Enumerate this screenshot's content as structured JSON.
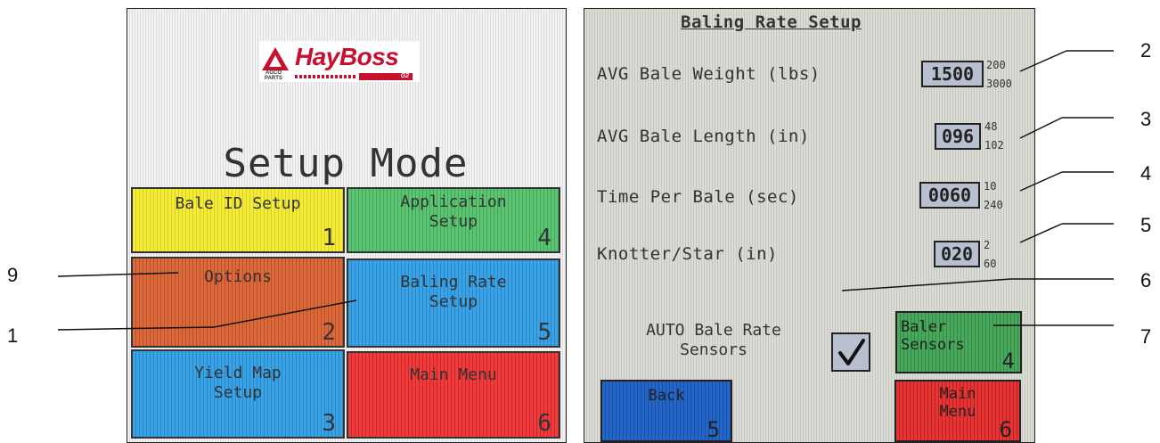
{
  "left_screen": {
    "logo": {
      "brand": "HayBoss",
      "badge": "G2",
      "maker": "AGCO PARTS"
    },
    "title": "Setup Mode",
    "tiles": [
      {
        "label": "Bale ID Setup",
        "number": "1"
      },
      {
        "label": "Application\nSetup",
        "number": "4"
      },
      {
        "label": "Options",
        "number": "2"
      },
      {
        "label": "Baling Rate\nSetup",
        "number": "5"
      },
      {
        "label": "Yield Map\nSetup",
        "number": "3"
      },
      {
        "label": "Main Menu",
        "number": "6"
      }
    ]
  },
  "right_screen": {
    "title": "Baling Rate Setup",
    "fields": [
      {
        "label": "AVG Bale Weight (lbs)",
        "value": "1500",
        "min": "200",
        "max": "3000"
      },
      {
        "label": "AVG Bale Length (in)",
        "value": "096",
        "min": "48",
        "max": "102"
      },
      {
        "label": "Time Per Bale (sec)",
        "value": "0060",
        "min": "10",
        "max": "240"
      },
      {
        "label": "Knotter/Star (in)",
        "value": "020",
        "min": "2",
        "max": "60"
      }
    ],
    "auto_label": "AUTO Bale Rate\nSensors",
    "auto_checked": true,
    "buttons": {
      "baler_sensors": {
        "label": "Baler\nSensors",
        "number": "4"
      },
      "back": {
        "label": "Back",
        "number": "5"
      },
      "main_menu": {
        "label": "Main\nMenu",
        "number": "6"
      }
    }
  },
  "callouts": {
    "left": [
      "9",
      "1"
    ],
    "right": [
      "2",
      "3",
      "4",
      "5",
      "6",
      "7"
    ]
  },
  "colors": {
    "tile_yellow": "#f5ec3a",
    "tile_green": "#5cc472",
    "tile_orange": "#dd6a3c",
    "tile_blue": "#3aa3e6",
    "tile_red": "#ef3d3d",
    "brand_red": "#c8102e",
    "field_bg": "#b8c0cf"
  }
}
